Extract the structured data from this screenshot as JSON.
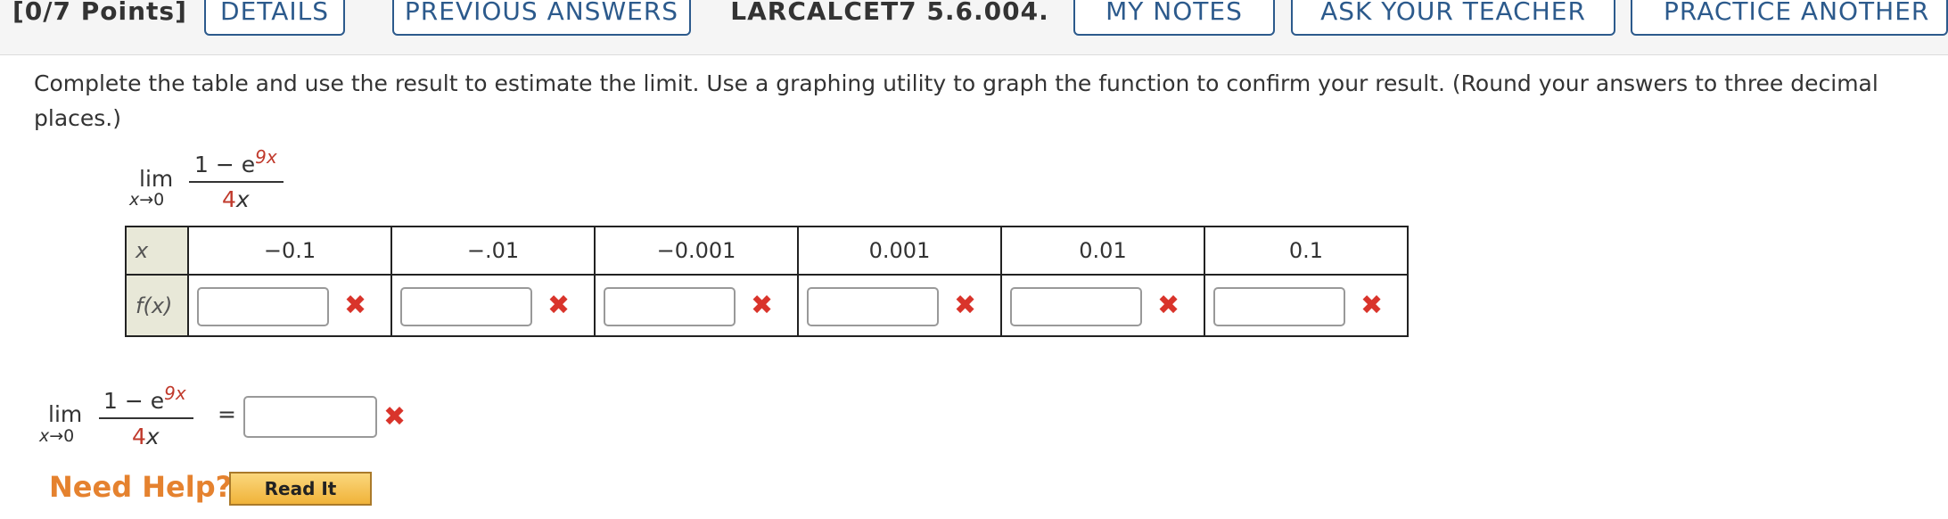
{
  "toolbar": {
    "points": "[0/7 Points]",
    "details": "DETAILS",
    "previous_answers": "PREVIOUS ANSWERS",
    "problem_id": "LARCALCET7 5.6.004.",
    "my_notes": "MY NOTES",
    "ask_teacher": "ASK YOUR TEACHER",
    "practice_another": "PRACTICE ANOTHER"
  },
  "question": {
    "text": "Complete the table and use the result to estimate the limit. Use a graphing utility to graph the function to confirm your result. (Round your answers to three decimal places.)"
  },
  "limit": {
    "word": "lim",
    "subscript": "x→0",
    "numerator_prefix": "1 − e",
    "exponent": "9x",
    "denominator_coef": "4",
    "denominator_var": "x"
  },
  "table": {
    "x_header": "x",
    "fx_header": "f(x)",
    "x_values": [
      "−0.1",
      "−.01",
      "−0.001",
      "0.001",
      "0.01",
      "0.1"
    ],
    "inputs": [
      "",
      "",
      "",
      "",
      "",
      ""
    ]
  },
  "answer": {
    "equals": "=",
    "value": ""
  },
  "help": {
    "label": "Need Help?",
    "read_it": "Read It"
  },
  "icons": {
    "wrong": "cross-mark-icon"
  }
}
